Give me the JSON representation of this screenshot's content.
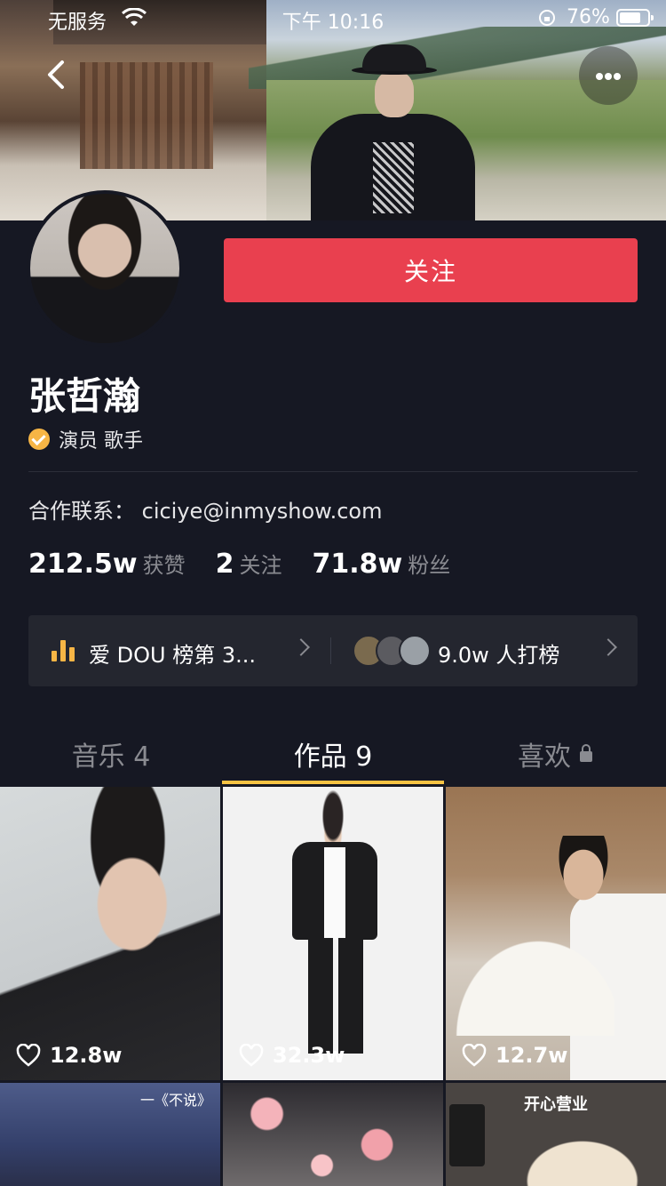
{
  "status_bar": {
    "carrier": "无服务",
    "time": "下午 10:16",
    "battery_percent": "76%",
    "battery_level": 0.76
  },
  "profile": {
    "follow_button": "关注",
    "name": "张哲瀚",
    "verified_title": "演员 歌手",
    "contact": "合作联系： ciciye@inmyshow.com"
  },
  "stats": [
    {
      "value": "212.5w",
      "label": "获赞"
    },
    {
      "value": "2",
      "label": "关注"
    },
    {
      "value": "71.8w",
      "label": "粉丝"
    }
  ],
  "rank": {
    "left_text": "爱 DOU 榜第 3...",
    "right_text": "9.0w 人打榜"
  },
  "tabs": [
    {
      "label": "音乐 4"
    },
    {
      "label": "作品 9"
    },
    {
      "label": "喜欢"
    }
  ],
  "videos": [
    {
      "likes": "12.8w"
    },
    {
      "likes": "32.3w"
    },
    {
      "likes": "12.7w"
    },
    {
      "caption": "一《不说》"
    },
    {},
    {
      "caption": "开心营业"
    }
  ],
  "colors": {
    "background": "#161823",
    "follow_button": "#e9404f",
    "tab_indicator": "#f6c343",
    "verified_badge": "#f6b545"
  },
  "icons": [
    "back-chevron-icon",
    "more-icon",
    "verified-icon",
    "chart-bars-icon",
    "chevron-right-icon",
    "lock-icon",
    "heart-icon",
    "wifi-icon"
  ]
}
